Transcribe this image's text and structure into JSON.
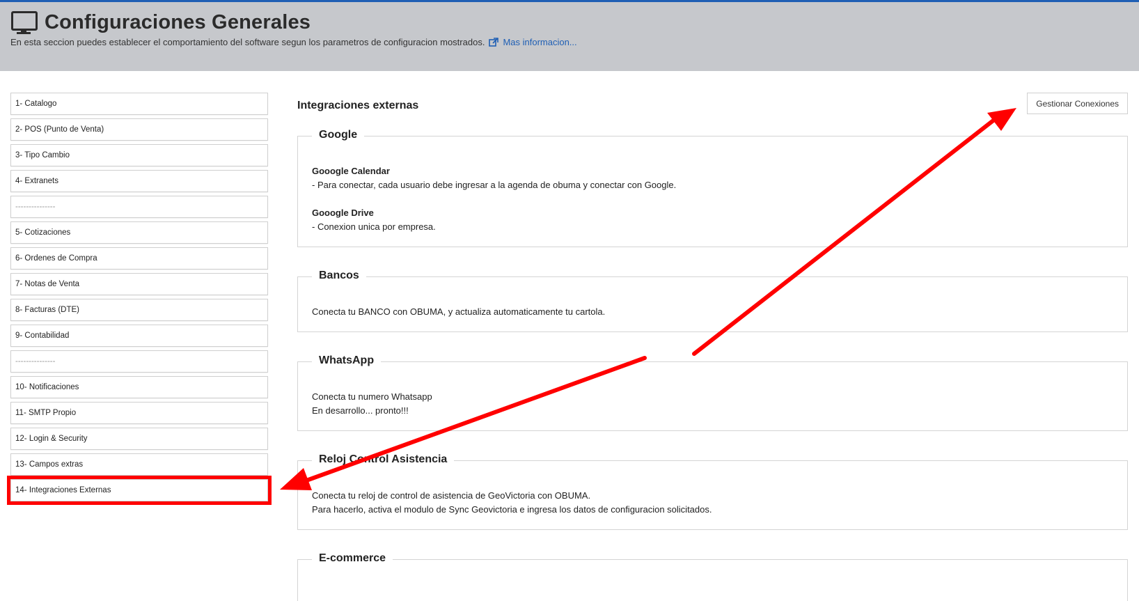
{
  "header": {
    "title": "Configuraciones Generales",
    "subtitle": "En esta seccion puedes establecer el comportamiento del software segun los parametros de configuracion mostrados.",
    "more_link": "Mas informacion...",
    "icon": "monitor-icon",
    "link_icon": "external-link-icon"
  },
  "sidebar": {
    "items": [
      "1- Catalogo",
      "2- POS (Punto de Venta)",
      "3- Tipo Cambio",
      "4- Extranets",
      "---------------",
      "5- Cotizaciones",
      "6- Ordenes de Compra",
      "7- Notas de Venta",
      "8- Facturas (DTE)",
      "9- Contabilidad",
      "---------------",
      "10- Notificaciones",
      "11- SMTP Propio",
      "12- Login & Security",
      "13- Campos extras",
      "14- Integraciones Externas"
    ],
    "selected": "14- Integraciones Externas"
  },
  "content": {
    "title": "Integraciones externas",
    "manage_button": "Gestionar Conexiones",
    "sections": {
      "google": {
        "legend": "Google",
        "calendar_title": "Gooogle Calendar",
        "calendar_text": "- Para conectar, cada usuario debe ingresar a la agenda de obuma y conectar con Google.",
        "drive_title": "Gooogle Drive",
        "drive_text": "- Conexion unica por empresa."
      },
      "bancos": {
        "legend": "Bancos",
        "text": "Conecta tu BANCO con OBUMA, y actualiza automaticamente tu cartola."
      },
      "whatsapp": {
        "legend": "WhatsApp",
        "line1": "Conecta tu numero Whatsapp",
        "line2": "En desarrollo... pronto!!!"
      },
      "reloj": {
        "legend": "Reloj Control Asistencia",
        "line1": "Conecta tu reloj de control de asistencia de GeoVictoria con OBUMA.",
        "line2": "Para hacerlo, activa el modulo de Sync Geovictoria e ingresa los datos de configuracion solicitados."
      },
      "ecommerce": {
        "legend": "E-commerce"
      }
    }
  },
  "colors": {
    "header_bg": "#c6c8cc",
    "link": "#1f5fb4",
    "annotation": "#ff0000"
  }
}
